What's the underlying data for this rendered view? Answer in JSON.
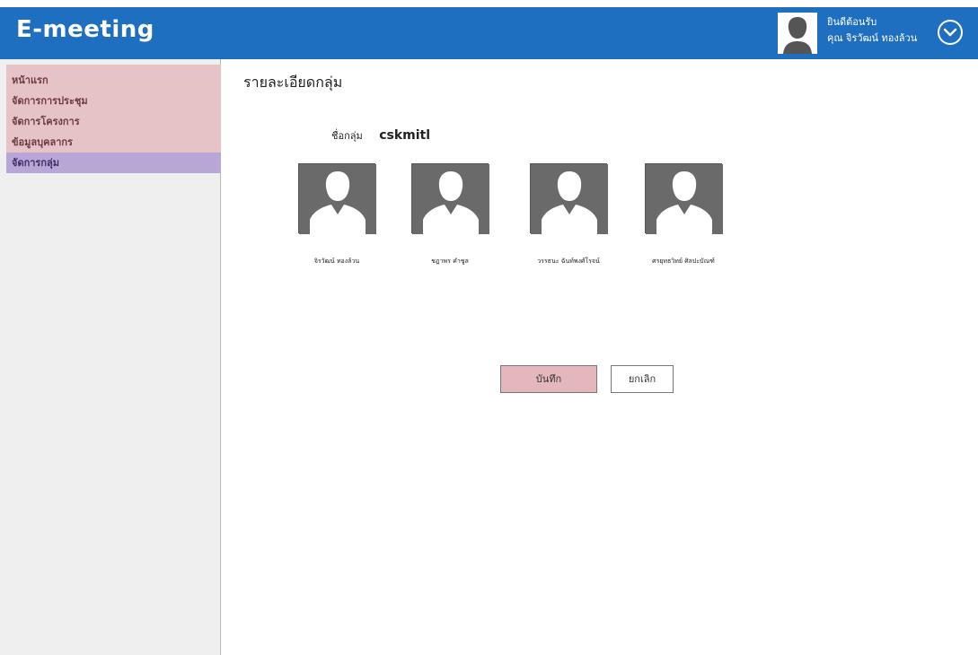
{
  "app": {
    "title": "E-meeting"
  },
  "header": {
    "welcome_line1": "ยินดีต้อนรับ",
    "welcome_line2": "คุณ จิรวัฒน์ ทองล้วน"
  },
  "sidebar": {
    "items": [
      {
        "label": "หน้าแรก"
      },
      {
        "label": "จัดการการประชุม"
      },
      {
        "label": "จัดการโครงการ"
      },
      {
        "label": "ข้อมูลบุคลากร"
      },
      {
        "label": "จัดการกลุ่ม"
      }
    ]
  },
  "main": {
    "title": "รายละเอียดกลุ่ม",
    "group_label": "ชื่อกลุ่ม",
    "group_name": "cskmitl",
    "members": [
      {
        "name": "จิรวัฒน์ ทองล้วน"
      },
      {
        "name": "ชฎาพร คำชูล"
      },
      {
        "name": "วรรธนะ ฉันท์พงศ์โรจน์"
      },
      {
        "name": "ศรยุทธวิทย์ ศิลปะบัณฑ์"
      }
    ],
    "save_label": "บันทึก",
    "cancel_label": "ยกเลิก"
  },
  "colors": {
    "header": "#1f6fc0",
    "sidebar_nav": "#e6c3c6",
    "sidebar_active": "#b7a6d6",
    "save_button": "#e4b7bc"
  },
  "icons": {
    "header_avatar": "user-avatar-icon",
    "user_menu": "chevron-down-circle-icon",
    "member_photo": "user-silhouette-icon"
  }
}
